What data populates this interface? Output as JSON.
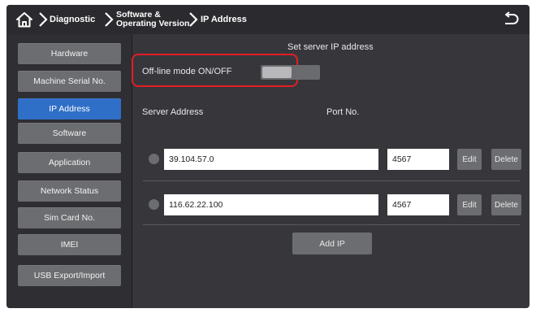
{
  "breadcrumb": {
    "diagnostic": "Diagnostic",
    "software_line1": "Software &",
    "software_line2": "Operating Version",
    "ip_address": "IP Address"
  },
  "icons": {
    "home": "home-icon",
    "separator": "chevron-right-icon",
    "back": "back-arrow-icon"
  },
  "sidebar": {
    "items": [
      {
        "label": "Hardware",
        "active": false
      },
      {
        "label": "Machine Serial No.",
        "active": false
      },
      {
        "label": "IP Address",
        "active": true
      },
      {
        "label": "Software",
        "active": false
      },
      {
        "label": "Application",
        "active": false
      },
      {
        "label": "Network Status",
        "active": false
      },
      {
        "label": "Sim Card No.",
        "active": false
      },
      {
        "label": "IMEI",
        "active": false
      },
      {
        "label": "USB Export/Import",
        "active": false
      }
    ]
  },
  "main": {
    "title": "Set server IP address",
    "offline_label": "Off-line mode ON/OFF",
    "offline_on": false,
    "server_address_header": "Server Address",
    "port_header": "Port No.",
    "servers": [
      {
        "address": "39.104.57.0",
        "port": "4567",
        "selected": false
      },
      {
        "address": "116.62.22.100",
        "port": "4567",
        "selected": false
      }
    ],
    "edit_label": "Edit",
    "delete_label": "Delete",
    "add_ip_label": "Add IP"
  },
  "colors": {
    "active_tab": "#2f6fc8",
    "highlight_box": "#e31e24",
    "background": "#37373b"
  }
}
